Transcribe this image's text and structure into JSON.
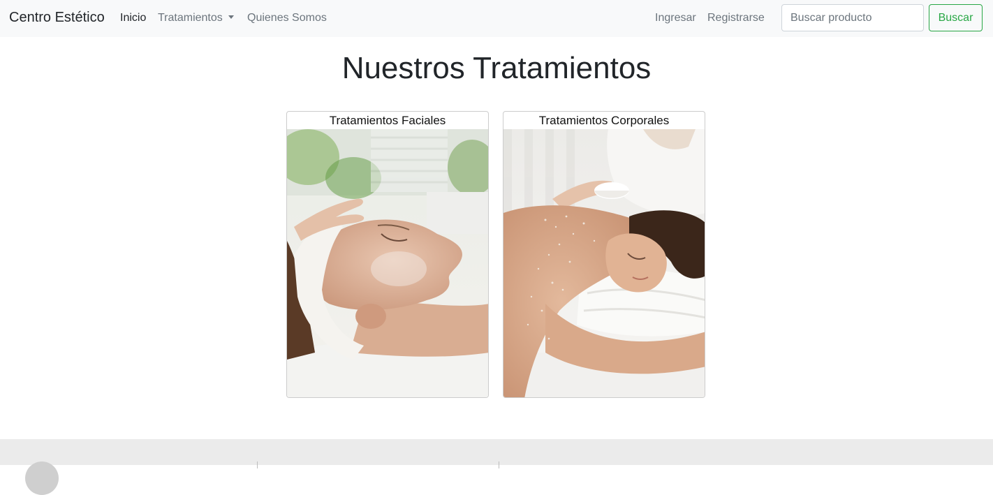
{
  "navbar": {
    "brand": "Centro Estético",
    "links": {
      "inicio": "Inicio",
      "tratamientos": "Tratamientos",
      "quienes_somos": "Quienes Somos",
      "ingresar": "Ingresar",
      "registrarse": "Registrarse"
    },
    "search": {
      "placeholder": "Buscar producto",
      "value": "",
      "button": "Buscar"
    }
  },
  "main": {
    "title": "Nuestros Tratamientos",
    "cards": [
      {
        "title": "Tratamientos Faciales"
      },
      {
        "title": "Tratamientos Corporales"
      }
    ]
  },
  "colors": {
    "navbar_bg": "#f8f9fa",
    "accent_green": "#28a745",
    "muted_link": "#6c757d",
    "footer_bg": "#ebebeb"
  }
}
